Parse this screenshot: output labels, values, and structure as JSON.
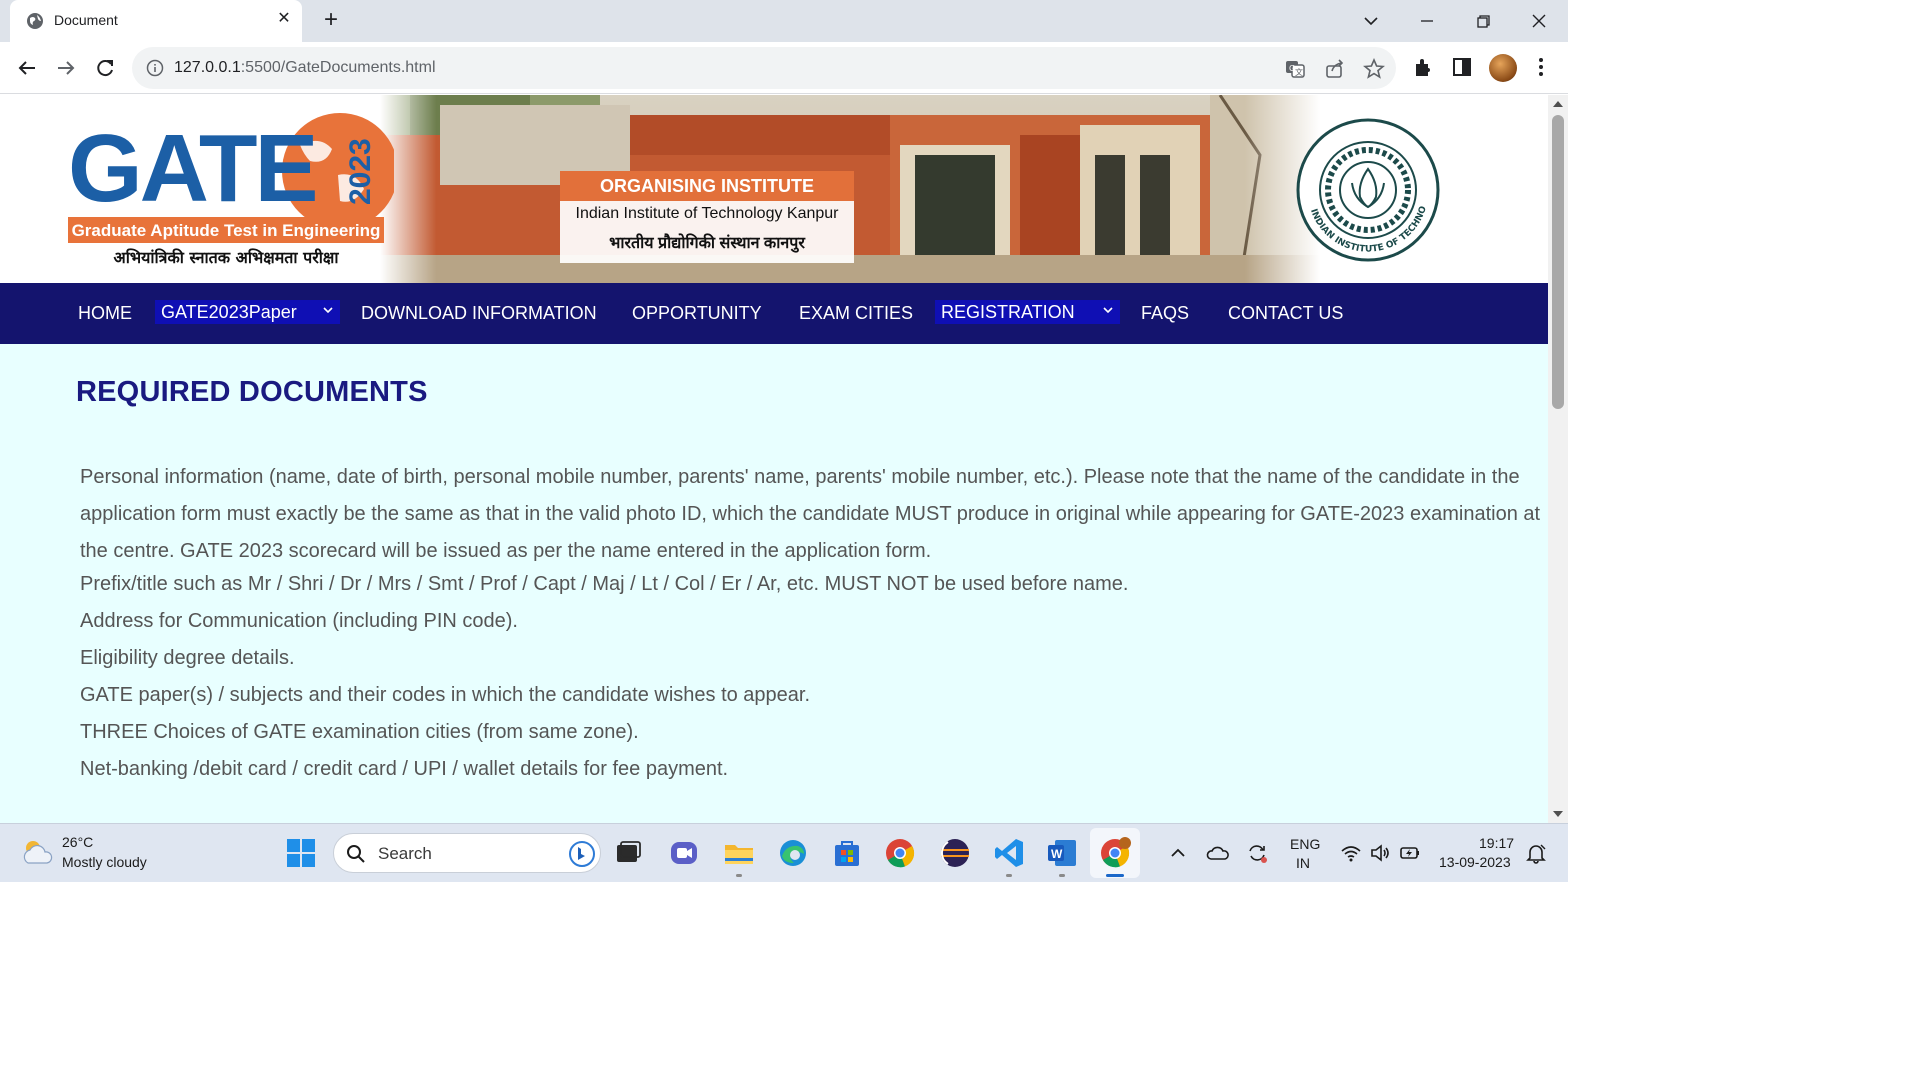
{
  "browser": {
    "tab_title": "Document",
    "close_symbol": "✕",
    "new_tab_symbol": "+",
    "url_host": "127.0.0.1",
    "url_rest": ":5500/GateDocuments.html"
  },
  "banner": {
    "logo_text": "GATE",
    "logo_year": "2023",
    "logo_subtitle": "Graduate Aptitude Test in Engineering",
    "logo_hindi": "अभियांत्रिकी स्नातक अभिक्षमता परीक्षा",
    "org_heading": "ORGANISING INSTITUTE",
    "org_name_en": "Indian Institute of Technology Kanpur",
    "org_name_hi": "भारतीय प्रौद्योगिकी संस्थान कानपुर",
    "seal_text_en": "INDIAN INSTITUTE OF TECHNOLOGY KANPUR"
  },
  "nav": {
    "home": "HOME",
    "paper_select": "GATE2023Paper",
    "download": "DOWNLOAD INFORMATION",
    "opportunity": "OPPORTUNITY",
    "exam_cities": "EXAM CITIES",
    "registration_select": "REGISTRATION",
    "faqs": "FAQS",
    "contact": "CONTACT US"
  },
  "content": {
    "heading": "REQUIRED DOCUMENTS",
    "paragraph": "Personal information (name, date of birth, personal mobile number, parents' name, parents' mobile number, etc.). Please note that the name of the candidate in the application form must exactly be the same as that in the valid photo ID, which the candidate MUST produce in original while appearing for GATE-2023 examination at the centre. GATE 2023 scorecard will be issued as per the name entered in the application form.",
    "items": [
      "Prefix/title such as Mr / Shri / Dr / Mrs / Smt / Prof / Capt / Maj / Lt / Col / Er / Ar, etc. MUST NOT be used before name.",
      "Address for Communication (including PIN code).",
      "Eligibility degree details.",
      "GATE paper(s) / subjects and their codes in which the candidate wishes to appear.",
      "THREE Choices of GATE examination cities (from same zone).",
      "Net-banking /debit card / credit card / UPI / wallet details for fee payment."
    ]
  },
  "taskbar": {
    "temperature": "26°C",
    "weather": "Mostly cloudy",
    "search_placeholder": "Search",
    "lang_line1": "ENG",
    "lang_line2": "IN",
    "time": "19:17",
    "date": "13-09-2023"
  },
  "colors": {
    "navbar": "#14146e",
    "select_bg": "#0f0fb4",
    "content_bg": "#e8ffff",
    "heading": "#1a1a80",
    "body_text": "#555555",
    "gate_blue": "#1c5fa6",
    "gate_orange": "#e8733a"
  }
}
